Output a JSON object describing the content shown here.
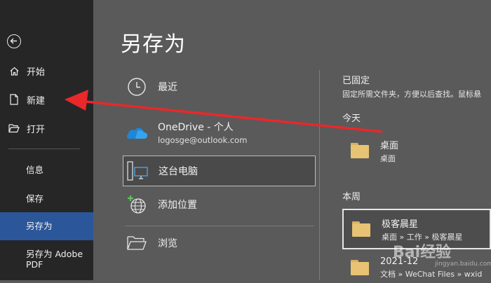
{
  "sidebar": {
    "items": [
      {
        "label": "开始",
        "icon": "home-icon"
      },
      {
        "label": "新建",
        "icon": "new-document-icon"
      },
      {
        "label": "打开",
        "icon": "open-folder-icon"
      }
    ],
    "sub_items": [
      {
        "label": "信息"
      },
      {
        "label": "保存"
      },
      {
        "label": "另存为"
      },
      {
        "label": "另存为 Adobe PDF"
      }
    ],
    "active_color": "#2b579a"
  },
  "page_title": "另存为",
  "locations": [
    {
      "label": "最近",
      "icon": "clock-icon"
    },
    {
      "label": "OneDrive - 个人",
      "sub": "logosge@outlook.com",
      "icon": "onedrive-cloud-icon"
    },
    {
      "label": "这台电脑",
      "icon": "this-pc-icon"
    },
    {
      "label": "添加位置",
      "icon": "add-location-globe-icon"
    },
    {
      "label": "浏览",
      "icon": "browse-folder-icon"
    }
  ],
  "pinned": {
    "title": "已固定",
    "description": "固定所需文件夹，方便以后查找。鼠标悬"
  },
  "today": {
    "title": "今天",
    "folders": [
      {
        "name": "桌面",
        "path": "桌面"
      }
    ]
  },
  "this_week": {
    "title": "本周",
    "folders": [
      {
        "name": "极客晨星",
        "path": "桌面 » 工作 » 极客晨星"
      },
      {
        "name": "2021-12",
        "path": "文档 » WeChat Files » wxid"
      }
    ]
  },
  "watermark": {
    "text": "Bai经验",
    "sub": "jingyan.baidu.com"
  },
  "annotation_color": "#e8282b"
}
